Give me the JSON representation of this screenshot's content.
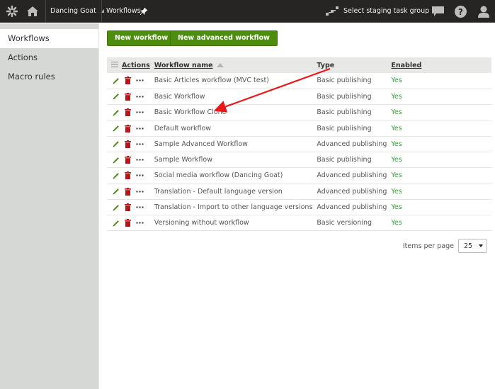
{
  "topbar": {
    "logo_icon": "kentico-logo-icon",
    "home_icon": "home-icon",
    "site_name": "Dancing Goat",
    "app_name": "Workflows",
    "pin_icon": "pin-icon",
    "staging_icon": "staging-icon",
    "staging_label": "Select staging task group",
    "chat_icon": "chat-icon",
    "help_icon": "help-icon",
    "user_icon": "user-icon"
  },
  "sidebar": {
    "items": [
      {
        "label": "Workflows",
        "active": true
      },
      {
        "label": "Actions",
        "active": false
      },
      {
        "label": "Macro rules",
        "active": false
      }
    ]
  },
  "toolbar": {
    "new_workflow_label": "New workflow",
    "new_advanced_workflow_label": "New advanced workflow"
  },
  "table": {
    "columns": {
      "actions": "Actions",
      "name": "Workflow name",
      "type": "Type",
      "enabled": "Enabled"
    },
    "sort": {
      "column": "name",
      "direction": "ascending"
    },
    "rows": [
      {
        "name": "Basic Articles workflow (MVC test)",
        "type": "Basic publishing",
        "enabled": "Yes"
      },
      {
        "name": "Basic Workflow",
        "type": "Basic publishing",
        "enabled": "Yes"
      },
      {
        "name": "Basic Workflow Clone",
        "type": "Basic publishing",
        "enabled": "Yes"
      },
      {
        "name": "Default workflow",
        "type": "Basic publishing",
        "enabled": "Yes"
      },
      {
        "name": "Sample Advanced Workflow",
        "type": "Advanced publishing",
        "enabled": "Yes"
      },
      {
        "name": "Sample Workflow",
        "type": "Basic publishing",
        "enabled": "Yes"
      },
      {
        "name": "Social media workflow (Dancing Goat)",
        "type": "Advanced publishing",
        "enabled": "Yes"
      },
      {
        "name": "Translation - Default language version",
        "type": "Advanced publishing",
        "enabled": "Yes"
      },
      {
        "name": "Translation - Import to other language versions",
        "type": "Advanced publishing",
        "enabled": "Yes"
      },
      {
        "name": "Versioning without workflow",
        "type": "Basic versioning",
        "enabled": "Yes"
      }
    ]
  },
  "pager": {
    "label": "Items per page",
    "value": "25"
  },
  "annotation": {
    "type": "red-arrow",
    "points_to": "Basic Workflow Clone",
    "color": "#e8191b"
  },
  "colors": {
    "topbar_bg": "#262524",
    "sidebar_bg": "#d6d8d5",
    "button_green": "#4d8c0e",
    "enabled_green": "#35a336",
    "edit_icon_green": "#4a8a12",
    "delete_icon_red": "#b3171b"
  }
}
